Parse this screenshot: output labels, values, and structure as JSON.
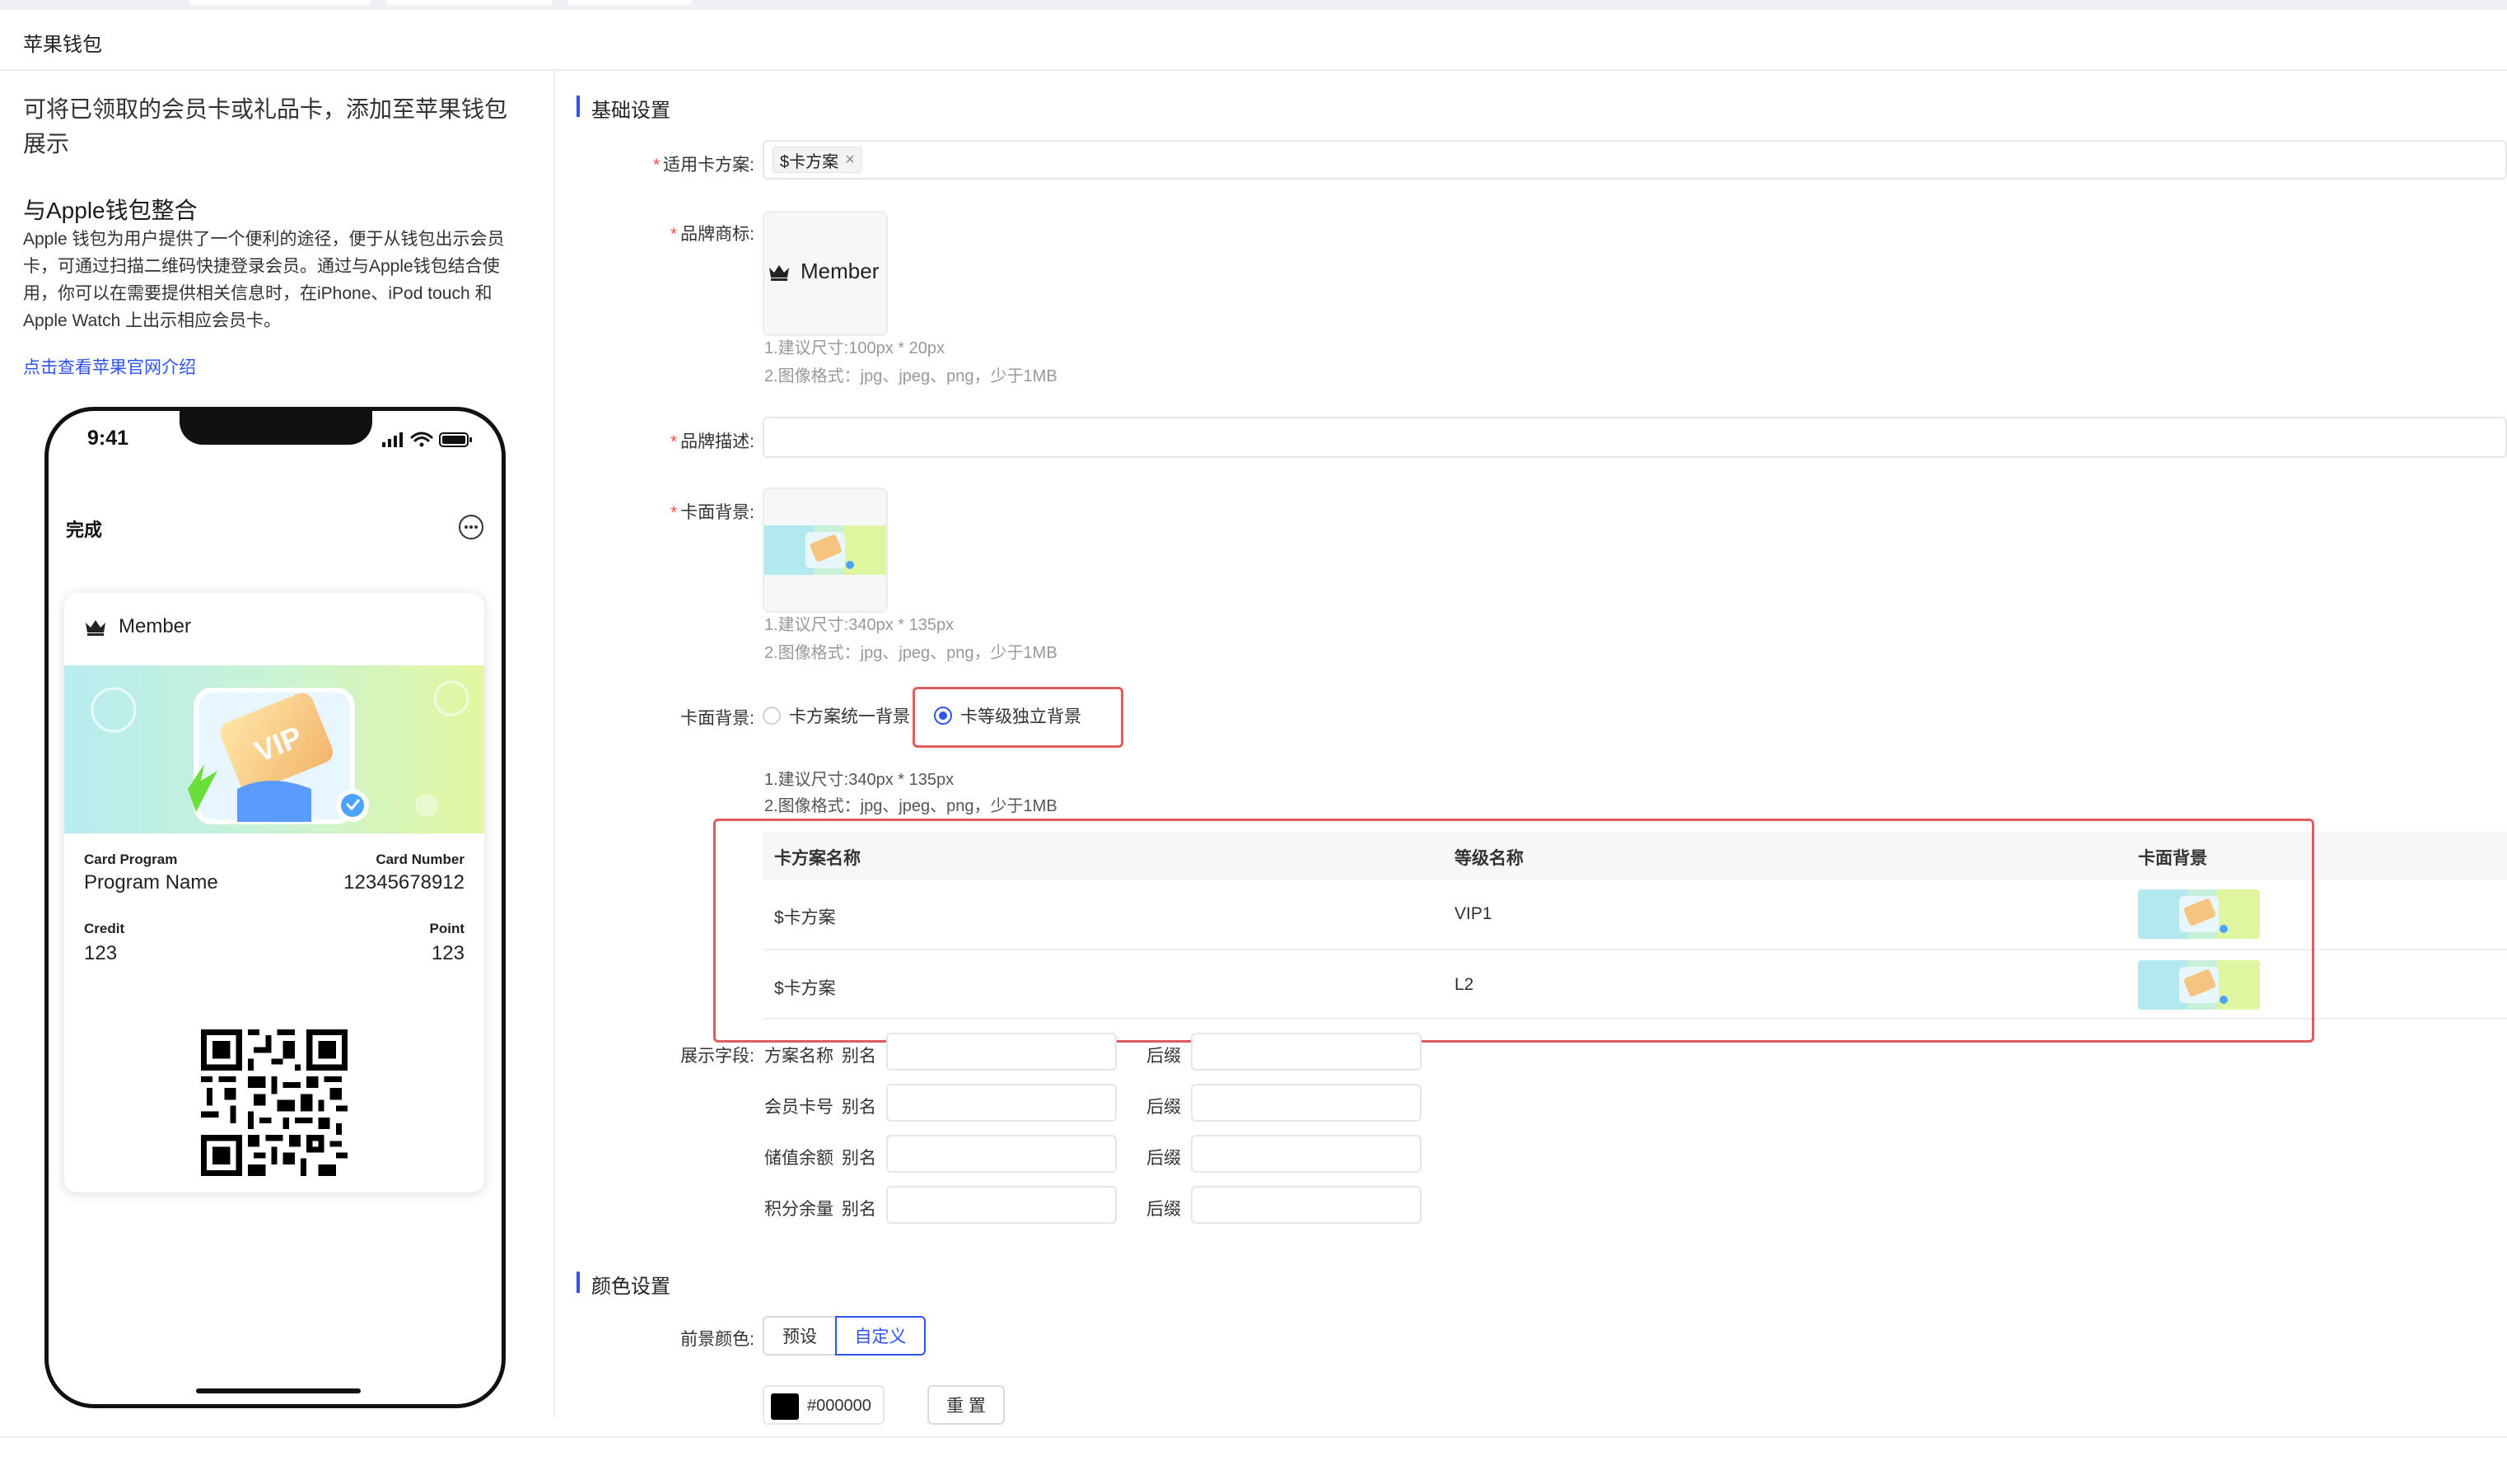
{
  "page": {
    "title": "苹果钱包"
  },
  "left": {
    "intro": "可将已领取的会员卡或礼品卡，添加至苹果钱包展示",
    "heading": "与Apple钱包整合",
    "paragraph": "Apple 钱包为用户提供了一个便利的途径，便于从钱包出示会员卡，可通过扫描二维码快捷登录会员。通过与Apple钱包结合使用，你可以在需要提供相关信息时，在iPhone、iPod touch 和 Apple Watch 上出示相应会员卡。",
    "link": "点击查看苹果官网介绍"
  },
  "phone": {
    "time": "9:41",
    "done": "完成",
    "card": {
      "brand": "Member",
      "card_program_label": "Card Program",
      "card_program_value": "Program Name",
      "card_number_label": "Card Number",
      "card_number_value": "12345678912",
      "credit_label": "Credit",
      "credit_value": "123",
      "point_label": "Point",
      "point_value": "123"
    }
  },
  "basic": {
    "section_title": "基础设置",
    "plan_label": "适用卡方案:",
    "plan_tag": "$卡方案",
    "logo_label": "品牌商标:",
    "logo_text": "Member",
    "logo_hint1": "1.建议尺寸:100px * 20px",
    "logo_hint2": "2.图像格式：jpg、jpeg、png，少于1MB",
    "desc_label": "品牌描述:",
    "bg_label": "卡面背景:",
    "bg_hint1": "1.建议尺寸:340px * 135px",
    "bg_hint2": "2.图像格式：jpg、jpeg、png，少于1MB",
    "bg_mode_label": "卡面背景:",
    "bg_mode_option1": "卡方案统一背景",
    "bg_mode_option2": "卡等级独立背景",
    "bg_mode_hint1": "1.建议尺寸:340px * 135px",
    "bg_mode_hint2": "2.图像格式：jpg、jpeg、png，少于1MB"
  },
  "level_table": {
    "columns": [
      "卡方案名称",
      "等级名称",
      "卡面背景"
    ],
    "rows": [
      {
        "plan": "$卡方案",
        "level": "VIP1"
      },
      {
        "plan": "$卡方案",
        "level": "L2"
      }
    ]
  },
  "display_fields": {
    "label": "展示字段:",
    "alias_label": "别名",
    "suffix_label": "后缀",
    "rows": [
      {
        "name": "方案名称",
        "alias": "",
        "suffix": ""
      },
      {
        "name": "会员卡号",
        "alias": "",
        "suffix": ""
      },
      {
        "name": "储值余额",
        "alias": "",
        "suffix": ""
      },
      {
        "name": "积分余量",
        "alias": "",
        "suffix": ""
      }
    ]
  },
  "color": {
    "section_title": "颜色设置",
    "fg_label": "前景颜色:",
    "preset_button": "预设",
    "custom_button": "自定义",
    "value": "#000000",
    "swatch": "#000000",
    "reset_button": "重 置"
  },
  "accent": "#2f54eb",
  "highlight": "#e05b5b"
}
